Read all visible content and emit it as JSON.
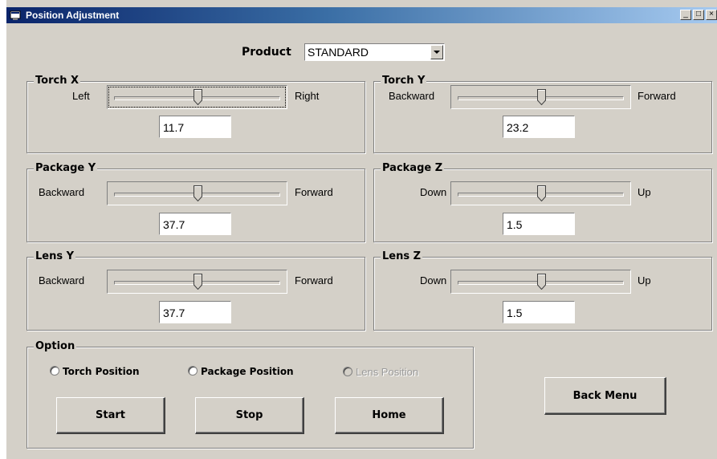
{
  "window": {
    "title": "Position Adjustment",
    "minimize_glyph": "_",
    "maximize_glyph": "□",
    "close_glyph": "×"
  },
  "product": {
    "label": "Product",
    "value": "STANDARD"
  },
  "groups": {
    "torch_x": {
      "title": "Torch X",
      "left_label": "Left",
      "right_label": "Right",
      "value": "11.7"
    },
    "torch_y": {
      "title": "Torch Y",
      "left_label": "Backward",
      "right_label": "Forward",
      "value": "23.2"
    },
    "package_y": {
      "title": "Package Y",
      "left_label": "Backward",
      "right_label": "Forward",
      "value": "37.7"
    },
    "package_z": {
      "title": "Package Z",
      "left_label": "Down",
      "right_label": "Up",
      "value": "1.5"
    },
    "lens_y": {
      "title": "Lens Y",
      "left_label": "Backward",
      "right_label": "Forward",
      "value": "37.7"
    },
    "lens_z": {
      "title": "Lens Z",
      "left_label": "Down",
      "right_label": "Up",
      "value": "1.5"
    }
  },
  "option": {
    "title": "Option",
    "radios": [
      "Torch Position",
      "Package Position",
      "Lens Position"
    ],
    "buttons": {
      "start": "Start",
      "stop": "Stop",
      "home": "Home"
    }
  },
  "back_menu": "Back Menu",
  "colors": {
    "face": "#d4d0c8",
    "title_start": "#0a246a",
    "title_end": "#a6caf0"
  }
}
